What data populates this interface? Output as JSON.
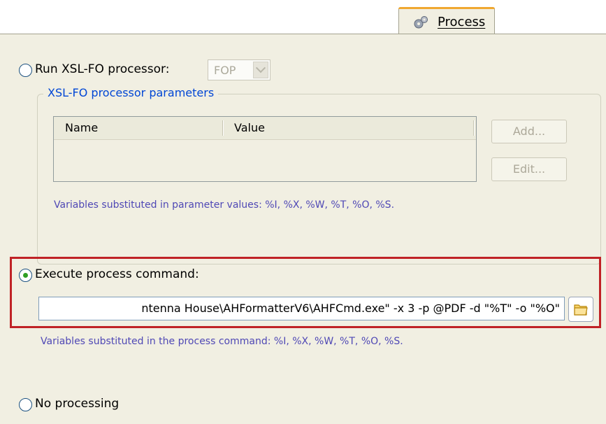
{
  "tab": {
    "label": "Process",
    "icon": "gears-icon"
  },
  "run_xslfo": {
    "label": "Run XSL-FO processor:",
    "selected": false,
    "processor": {
      "value": "FOP",
      "enabled": false
    }
  },
  "params_group": {
    "title": "XSL-FO processor parameters",
    "columns": [
      "Name",
      "Value"
    ],
    "rows": [],
    "add_label": "Add...",
    "edit_label": "Edit...",
    "hint": "Variables substituted in parameter values: %I, %X, %W, %T, %O, %S."
  },
  "execute": {
    "label": "Execute process command:",
    "selected": true,
    "command": "ntenna House\\AHFormatterV6\\AHFCmd.exe\" -x 3 -p @PDF -d \"%T\" -o \"%O\"",
    "browse_icon": "folder-icon",
    "hint": "Variables substituted in the process command: %I, %X, %W, %T, %O, %S."
  },
  "no_processing": {
    "label": "No processing",
    "selected": false
  },
  "colors": {
    "highlight_border": "#c02226",
    "hint_text": "#4f48b5",
    "group_title": "#0046d5",
    "panel": "#f1efe2"
  }
}
